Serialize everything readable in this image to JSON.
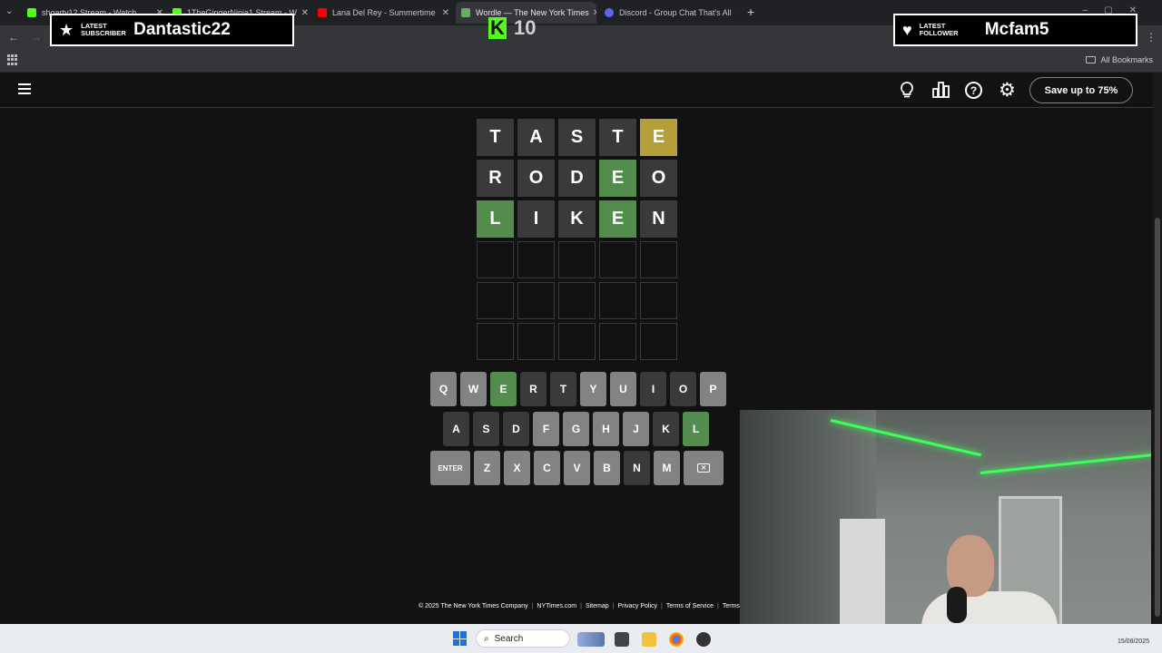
{
  "browser": {
    "tabs": [
      {
        "label": "shoarty12 Stream - Watch",
        "favicon_color": "#53fc18"
      },
      {
        "label": "1TheGingerNinja1 Stream - W",
        "favicon_color": "#53fc18"
      },
      {
        "label": "Lana Del Rey - Summertime",
        "favicon_color": "#ff0000"
      },
      {
        "label": "Wordle — The New York Times",
        "favicon_color": "#6aaa64",
        "active": true
      },
      {
        "label": "Discord - Group Chat That's All",
        "favicon_color": "#5865f2"
      }
    ],
    "bookmarks_label": "All Bookmarks"
  },
  "overlay": {
    "subscriber": {
      "small_label": "LATEST SUBSCRIBER",
      "name": "Dantastic22",
      "icon": "star-icon"
    },
    "follower": {
      "small_label": "LATEST FOLLOWER",
      "name": "Mcfam5",
      "icon": "heart-icon"
    },
    "viewer_count": "10"
  },
  "wordle": {
    "subscribe_label": "Save up to 75%",
    "icons": [
      "menu-icon",
      "hint-icon",
      "stats-icon",
      "help-icon",
      "settings-icon"
    ],
    "board": [
      [
        {
          "l": "T",
          "s": "absent"
        },
        {
          "l": "A",
          "s": "absent"
        },
        {
          "l": "S",
          "s": "absent"
        },
        {
          "l": "T",
          "s": "absent"
        },
        {
          "l": "E",
          "s": "present"
        }
      ],
      [
        {
          "l": "R",
          "s": "absent"
        },
        {
          "l": "O",
          "s": "absent"
        },
        {
          "l": "D",
          "s": "absent"
        },
        {
          "l": "E",
          "s": "correct"
        },
        {
          "l": "O",
          "s": "absent"
        }
      ],
      [
        {
          "l": "L",
          "s": "correct"
        },
        {
          "l": "I",
          "s": "absent"
        },
        {
          "l": "K",
          "s": "absent"
        },
        {
          "l": "E",
          "s": "correct"
        },
        {
          "l": "N",
          "s": "absent"
        }
      ],
      [
        {
          "l": "",
          "s": "empty"
        },
        {
          "l": "",
          "s": "empty"
        },
        {
          "l": "",
          "s": "empty"
        },
        {
          "l": "",
          "s": "empty"
        },
        {
          "l": "",
          "s": "empty"
        }
      ],
      [
        {
          "l": "",
          "s": "empty"
        },
        {
          "l": "",
          "s": "empty"
        },
        {
          "l": "",
          "s": "empty"
        },
        {
          "l": "",
          "s": "empty"
        },
        {
          "l": "",
          "s": "empty"
        }
      ],
      [
        {
          "l": "",
          "s": "empty"
        },
        {
          "l": "",
          "s": "empty"
        },
        {
          "l": "",
          "s": "empty"
        },
        {
          "l": "",
          "s": "empty"
        },
        {
          "l": "",
          "s": "empty"
        }
      ]
    ],
    "keyboard": [
      [
        {
          "k": "Q",
          "s": "unused"
        },
        {
          "k": "W",
          "s": "unused"
        },
        {
          "k": "E",
          "s": "correct"
        },
        {
          "k": "R",
          "s": "absent"
        },
        {
          "k": "T",
          "s": "absent"
        },
        {
          "k": "Y",
          "s": "unused"
        },
        {
          "k": "U",
          "s": "unused"
        },
        {
          "k": "I",
          "s": "absent"
        },
        {
          "k": "O",
          "s": "absent"
        },
        {
          "k": "P",
          "s": "unused"
        }
      ],
      [
        {
          "k": "A",
          "s": "absent"
        },
        {
          "k": "S",
          "s": "absent"
        },
        {
          "k": "D",
          "s": "absent"
        },
        {
          "k": "F",
          "s": "unused"
        },
        {
          "k": "G",
          "s": "unused"
        },
        {
          "k": "H",
          "s": "unused"
        },
        {
          "k": "J",
          "s": "unused"
        },
        {
          "k": "K",
          "s": "absent"
        },
        {
          "k": "L",
          "s": "correct"
        }
      ],
      [
        {
          "k": "ENTER",
          "s": "unused",
          "wide": true
        },
        {
          "k": "Z",
          "s": "unused"
        },
        {
          "k": "X",
          "s": "unused"
        },
        {
          "k": "C",
          "s": "unused"
        },
        {
          "k": "V",
          "s": "unused"
        },
        {
          "k": "B",
          "s": "unused"
        },
        {
          "k": "N",
          "s": "absent"
        },
        {
          "k": "M",
          "s": "unused"
        },
        {
          "k": "⌫",
          "s": "unused",
          "wide": true,
          "backspace": true
        }
      ]
    ],
    "footer": [
      "© 2025 The New York Times Company",
      "NYTimes.com",
      "Sitemap",
      "Privacy Policy",
      "Terms of Service",
      "Terms of Sale"
    ]
  },
  "taskbar": {
    "search_label": "Search",
    "date": "15/08/2025"
  },
  "colors": {
    "absent": "#3a3a3c",
    "present": "#b59f3b",
    "correct": "#538d4e",
    "unused_key": "#818384",
    "background": "#121213"
  }
}
